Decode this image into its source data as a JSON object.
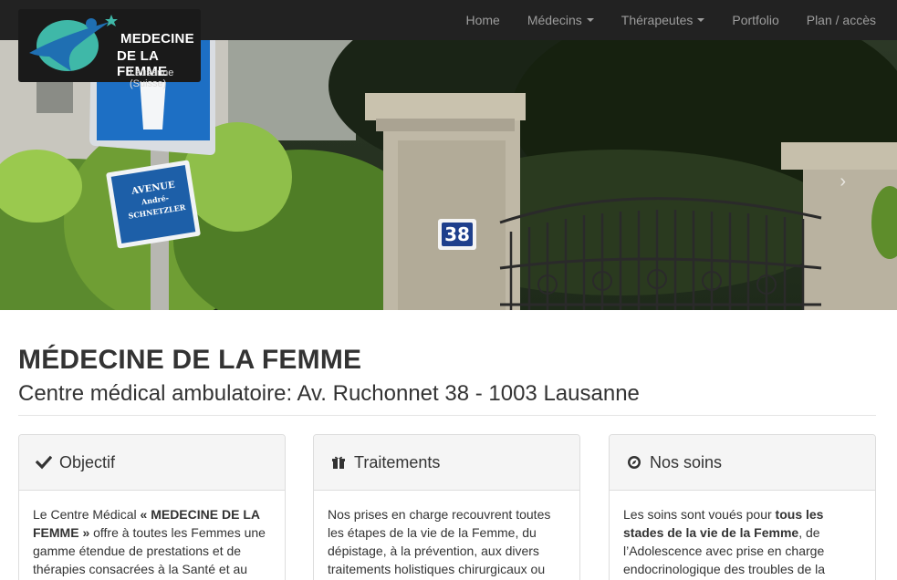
{
  "nav": {
    "items": [
      {
        "label": "Home",
        "dropdown": false
      },
      {
        "label": "Médecins",
        "dropdown": true
      },
      {
        "label": "Thérapeutes",
        "dropdown": true
      },
      {
        "label": "Portfolio",
        "dropdown": false
      },
      {
        "label": "Plan / accès",
        "dropdown": false
      }
    ]
  },
  "logo": {
    "line1": "MEDECINE",
    "line2": "DE LA FEMME",
    "line3": "Lausanne (Suisse)"
  },
  "hero": {
    "sign_line1": "AVENUE",
    "sign_line2": "André-SCHNETZLER",
    "house_number": "38",
    "next_icon": "chevron-right-icon"
  },
  "header": {
    "title": "MÉDECINE DE LA FEMME",
    "subtitle": "Centre médical ambulatoire: Av. Ruchonnet 38 - 1003 Lausanne"
  },
  "panels": [
    {
      "icon": "check-icon",
      "title": "Objectif",
      "body": [
        {
          "text": "Le Centre Médical ",
          "bold": false
        },
        {
          "text": "« MEDECINE DE LA FEMME »",
          "bold": true
        },
        {
          "text": " offre à toutes les Femmes une gamme étendue de prestations et de thérapies consacrées à la Santé et au",
          "bold": false
        }
      ]
    },
    {
      "icon": "gift-icon",
      "title": "Traitements",
      "body": [
        {
          "text": "Nos prises en charge recouvrent toutes les étapes de la vie de la Femme, du dépistage, à la prévention, aux divers traitements holistiques chirurgicaux ou",
          "bold": false
        }
      ]
    },
    {
      "icon": "compass-icon",
      "title": "Nos soins",
      "body": [
        {
          "text": "Les soins sont voués pour ",
          "bold": false
        },
        {
          "text": "tous les stades de la vie de la Femme",
          "bold": true
        },
        {
          "text": ", de l’Adolescence avec prise en charge endocrinologique des troubles de la",
          "bold": false
        }
      ]
    }
  ],
  "colors": {
    "navbar": "#222222",
    "nav_text": "#9d9d9d",
    "logo_bg": "#1a1a1a",
    "logo_accent": "#3fb8a8",
    "logo_blue": "#1f6fb2",
    "panel_heading_bg": "#f5f5f5"
  }
}
